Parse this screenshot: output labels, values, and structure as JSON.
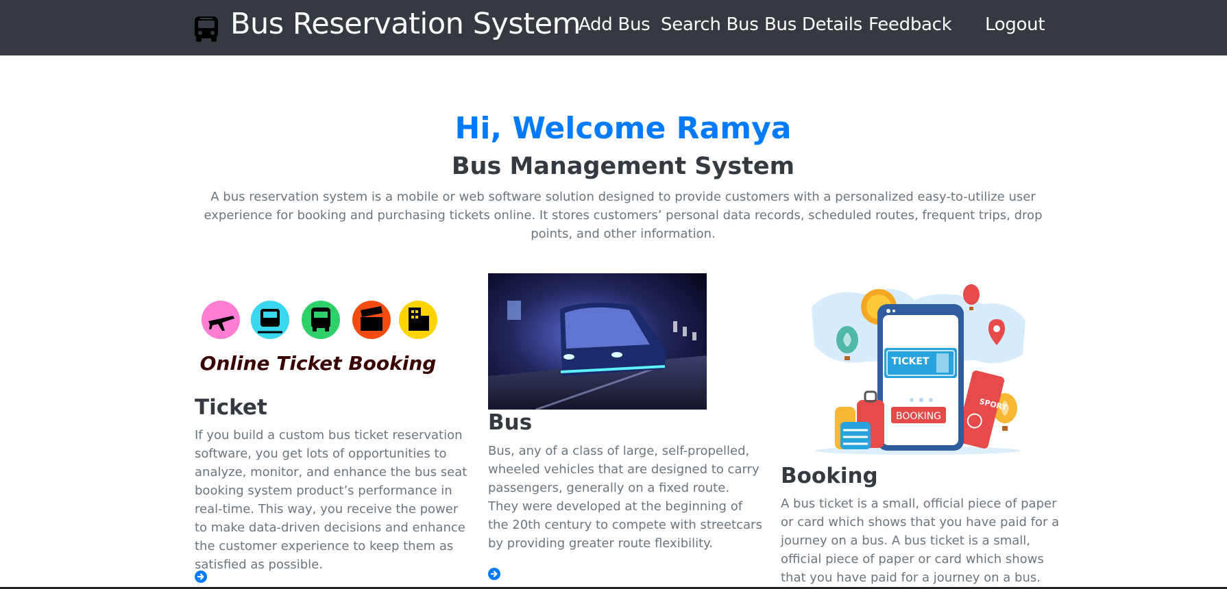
{
  "navbar": {
    "brand_icon": "bus-icon",
    "brand_title": "Bus Reservation System",
    "links": [
      "Add Bus",
      "Search Bus",
      "Bus Details",
      "Feedback"
    ],
    "logout": "Logout"
  },
  "hero": {
    "welcome": "Hi, Welcome Ramya",
    "subtitle": "Bus Management System",
    "intro": "A bus reservation system is a mobile or web software solution designed to provide customers with a personalized easy-to-utilize user experience for booking and purchasing tickets online. It stores customers’ personal data records, scheduled routes, frequent trips, drop points, and other information."
  },
  "cards": [
    {
      "image_caption": "Online Ticket Booking",
      "image_icons": [
        "airplane-icon",
        "train-icon",
        "bus-icon",
        "clapperboard-icon",
        "hotel-icon"
      ],
      "title": "Ticket",
      "text": "If you build a custom bus ticket reservation software, you get lots of opportunities to analyze, monitor, and enhance the bus seat booking system product’s performance in real-time. This way, you receive the power to make data-driven decisions and enhance the customer experience to keep them as satisfied as possible.",
      "link_icon": "arrow-circle-right-icon"
    },
    {
      "title": "Bus",
      "text": "Bus, any of a class of large, self-propelled, wheeled vehicles that are designed to carry passengers, generally on a fixed route. They were developed at the beginning of the 20th century to compete with streetcars by providing greater route flexibility.",
      "link_icon": "arrow-circle-right-icon"
    },
    {
      "image_ticket_label": "TICKET",
      "image_booking_label": "BOOKING",
      "image_passport_label": "SPORT",
      "title": "Booking",
      "text": "A bus ticket is a small, official piece of paper or card which shows that you have paid for a journey on a bus. A bus ticket is a small, official piece of paper or card which shows that you have paid for a journey on a bus."
    }
  ],
  "colors": {
    "navbar": "#343a40",
    "accent": "#007bff",
    "muted_text": "#6c757d"
  }
}
